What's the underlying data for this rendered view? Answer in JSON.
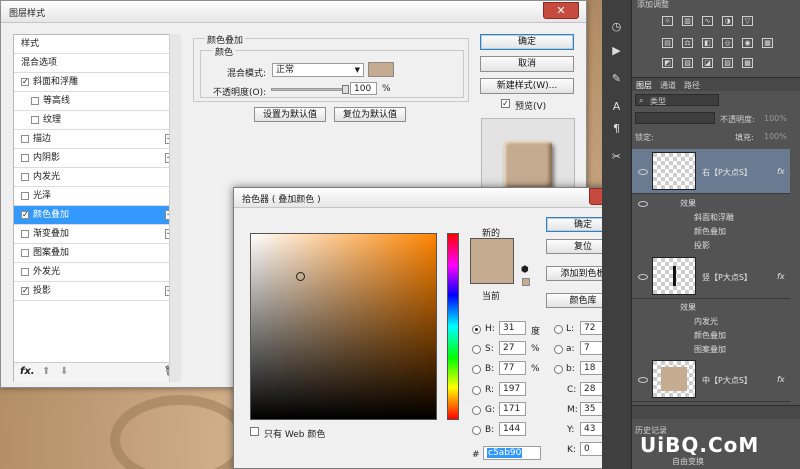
{
  "layer_style": {
    "title": "图层样式",
    "left_items": [
      {
        "label": "样式",
        "checkbox": false,
        "plus": false,
        "checked": false,
        "selected": false,
        "indent": 0
      },
      {
        "label": "混合选项",
        "checkbox": false,
        "plus": false,
        "checked": false,
        "selected": false,
        "indent": 0
      },
      {
        "label": "斜面和浮雕",
        "checkbox": true,
        "plus": false,
        "checked": true,
        "selected": false,
        "indent": 0
      },
      {
        "label": "等高线",
        "checkbox": true,
        "plus": false,
        "checked": false,
        "selected": false,
        "indent": 1
      },
      {
        "label": "纹理",
        "checkbox": true,
        "plus": false,
        "checked": false,
        "selected": false,
        "indent": 1
      },
      {
        "label": "描边",
        "checkbox": true,
        "plus": true,
        "checked": false,
        "selected": false,
        "indent": 0
      },
      {
        "label": "内阴影",
        "checkbox": true,
        "plus": true,
        "checked": false,
        "selected": false,
        "indent": 0
      },
      {
        "label": "内发光",
        "checkbox": true,
        "plus": false,
        "checked": false,
        "selected": false,
        "indent": 0
      },
      {
        "label": "光泽",
        "checkbox": true,
        "plus": false,
        "checked": false,
        "selected": false,
        "indent": 0
      },
      {
        "label": "颜色叠加",
        "checkbox": true,
        "plus": true,
        "checked": true,
        "selected": true,
        "indent": 0
      },
      {
        "label": "渐变叠加",
        "checkbox": true,
        "plus": true,
        "checked": false,
        "selected": false,
        "indent": 0
      },
      {
        "label": "图案叠加",
        "checkbox": true,
        "plus": false,
        "checked": false,
        "selected": false,
        "indent": 0
      },
      {
        "label": "外发光",
        "checkbox": true,
        "plus": false,
        "checked": false,
        "selected": false,
        "indent": 0
      },
      {
        "label": "投影",
        "checkbox": true,
        "plus": true,
        "checked": true,
        "selected": false,
        "indent": 0
      }
    ],
    "fx_label": "fx.",
    "section_title": "颜色叠加",
    "subsection_title": "颜色",
    "blend_mode_label": "混合模式:",
    "blend_mode_value": "正常",
    "overlay_color": "#c5ab90",
    "opacity_label": "不透明度(O):",
    "opacity_value": "100",
    "opacity_unit": "%",
    "opacity_fraction": 1.0,
    "set_default": "设置为默认值",
    "reset_default": "复位为默认值",
    "ok": "确定",
    "cancel": "取消",
    "new_style": "新建样式(W)...",
    "preview_label": "预览(V)",
    "preview_checked": true
  },
  "color_picker": {
    "title": "拾色器 ( 叠加颜色 )",
    "new_label": "新的",
    "current_label": "当前",
    "new_color": "#c5ab90",
    "current_color": "#c5ab90",
    "ok": "确定",
    "reset": "复位",
    "add_swatch": "添加到色板",
    "color_libraries": "颜色库",
    "web_only": "只有 Web 颜色",
    "hsb": {
      "h": "31",
      "h_unit": "度",
      "s": "27",
      "s_unit": "%",
      "b": "77",
      "b_unit": "%"
    },
    "rgb": {
      "r": "197",
      "g": "171",
      "b": "144"
    },
    "lab": {
      "l": "72",
      "a": "7",
      "b": "18"
    },
    "cmyk": {
      "c": "28",
      "m": "35",
      "y": "43",
      "k": "0",
      "unit": "%"
    },
    "hex_label": "#",
    "hex": "c5ab90",
    "labels": {
      "h": "H:",
      "s": "S:",
      "b": "B:",
      "r": "R:",
      "g": "G:",
      "bb": "B:",
      "l": "L:",
      "a": "a:",
      "lb": "b:",
      "c": "C:",
      "m": "M:",
      "y": "Y:",
      "k": "K:"
    }
  },
  "ps_panel": {
    "adjust_title": "添加调整",
    "tabs": [
      "图层",
      "通道",
      "路径"
    ],
    "kind_label": "类型",
    "opacity_label": "不透明度:",
    "opacity_value": "100%",
    "lock_label": "锁定:",
    "fill_label": "填充:",
    "fill_value": "100%",
    "layers": [
      {
        "name": "右【P大点S】",
        "fx": "fx",
        "effects_label": "效果",
        "effects": [
          "斜面和浮雕",
          "颜色叠加",
          "投影"
        ],
        "selected": true
      },
      {
        "name": "竖【P大点S】",
        "fx": "fx",
        "effects_label": "效果",
        "effects": [
          "内发光",
          "颜色叠加",
          "图案叠加"
        ],
        "selected": false
      },
      {
        "name": "中【P大点S】",
        "fx": "fx",
        "effects_label": "",
        "effects": [],
        "selected": false
      }
    ],
    "history_label": "历史记录",
    "bottom_text": "自由变换"
  },
  "watermark": "UiBQ.CoM"
}
